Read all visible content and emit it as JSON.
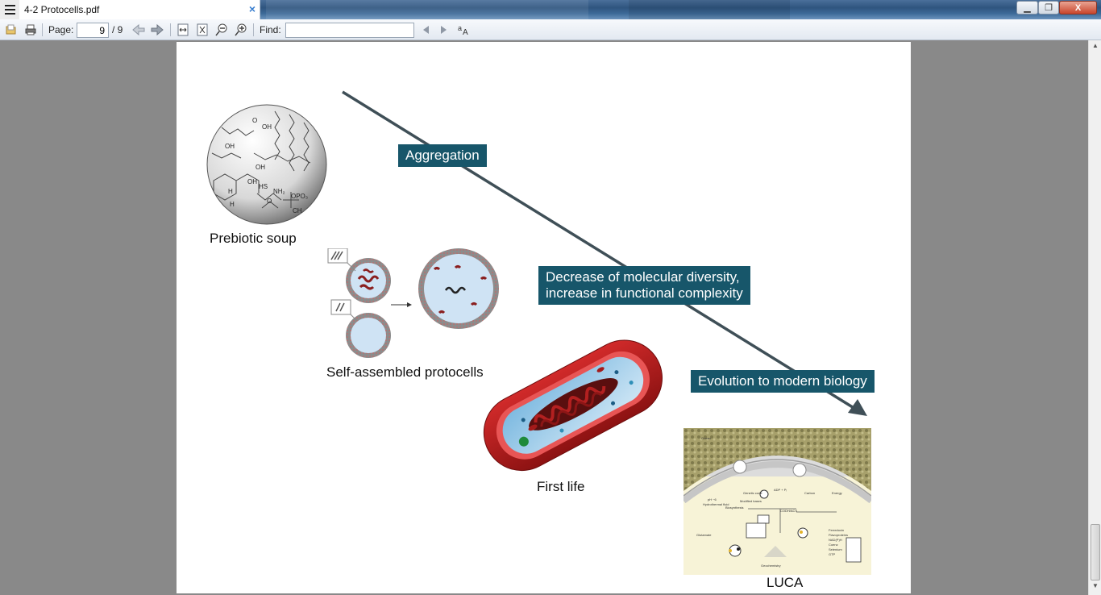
{
  "window": {
    "tab_title": "4-2 Protocells.pdf",
    "tab_close": "×",
    "min_glyph": "▁",
    "max_glyph": "❐",
    "close_glyph": "X"
  },
  "toolbar": {
    "page_label": "Page:",
    "page_value": "9",
    "page_total": "/ 9",
    "find_label": "Find:",
    "find_value": ""
  },
  "icons": [
    "menu-icon",
    "open-file-icon",
    "print-icon",
    "prev-page-icon",
    "next-page-icon",
    "fit-width-icon",
    "fit-page-icon",
    "zoom-out-icon",
    "zoom-in-icon",
    "find-prev-icon",
    "find-next-icon",
    "match-case-icon"
  ],
  "slide": {
    "callout_aggregation": "Aggregation",
    "callout_decrease_line1": "Decrease of molecular diversity,",
    "callout_decrease_line2": "increase in functional complexity",
    "callout_evolution": "Evolution to modern biology",
    "caption_soup": "Prebiotic soup",
    "caption_protocells": "Self-assembled protocells",
    "caption_first_life": "First life",
    "caption_luca": "LUCA",
    "accent_color": "#17566a",
    "arrow_color": "#3f4f57"
  }
}
